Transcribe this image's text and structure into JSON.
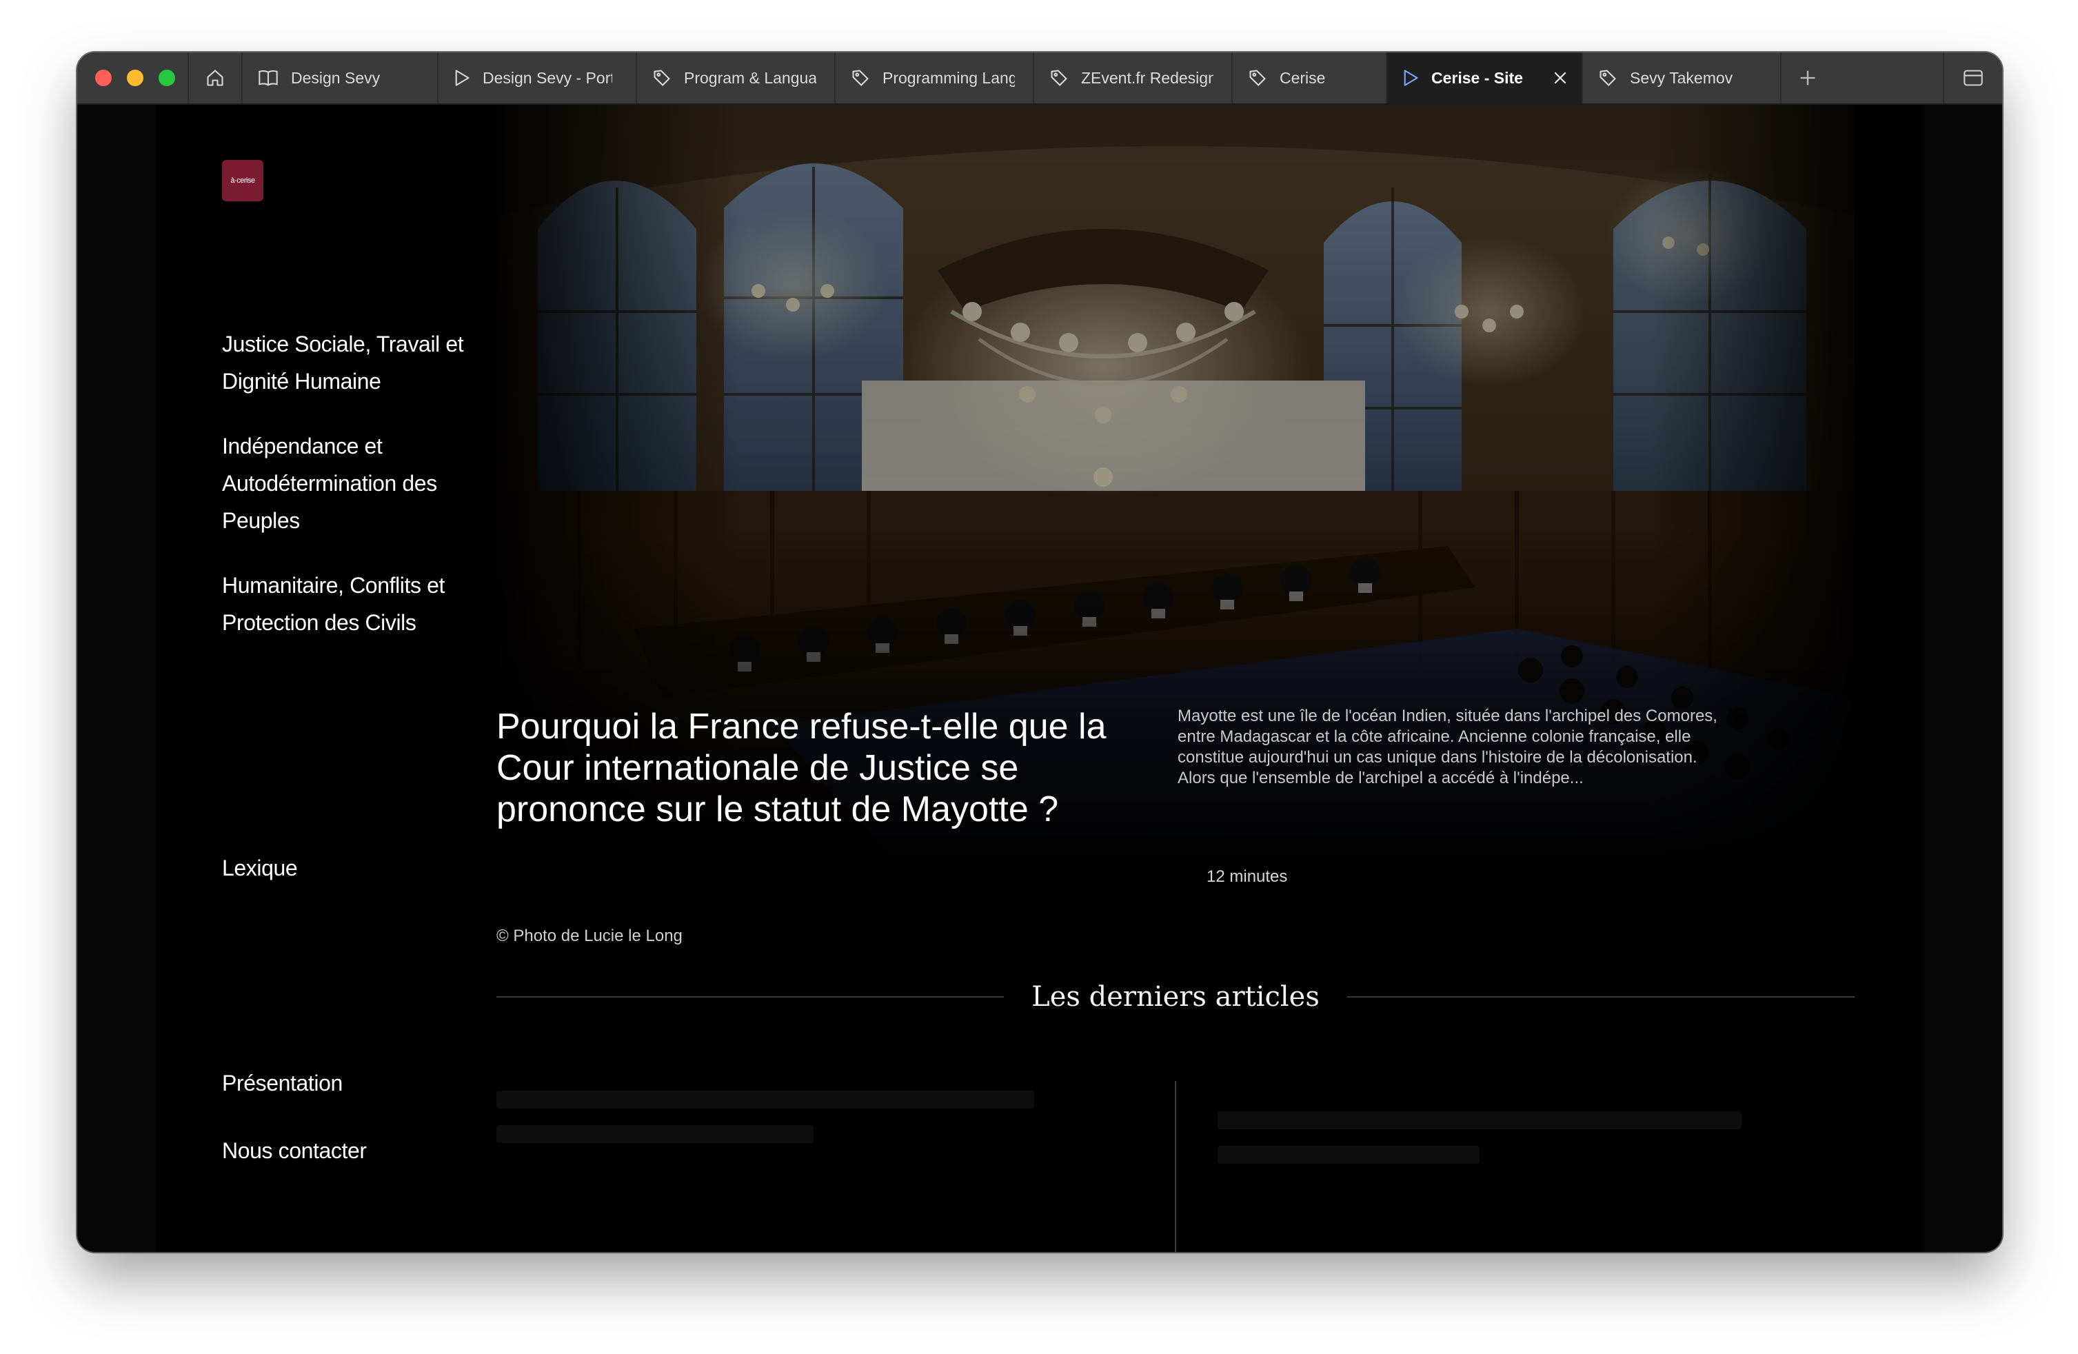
{
  "browser": {
    "tabs": [
      {
        "label": "Design Sevy",
        "icon": "book-icon",
        "active": false
      },
      {
        "label": "Design Sevy - Portfolio",
        "icon": "play-icon",
        "active": false
      },
      {
        "label": "Program & Languages",
        "icon": "tag-icon",
        "active": false
      },
      {
        "label": "Programming Languages",
        "icon": "tag-icon",
        "active": false
      },
      {
        "label": "ZEvent.fr Redesign",
        "icon": "tag-icon",
        "active": false
      },
      {
        "label": "Cerise",
        "icon": "tag-icon",
        "active": false
      },
      {
        "label": "Cerise - Site",
        "icon": "play-icon",
        "active": true
      },
      {
        "label": "Sevy Takemov",
        "icon": "tag-icon",
        "active": false
      }
    ]
  },
  "site": {
    "logo_text": "à·cerise",
    "nav": {
      "item1": "Justice Sociale, Travail et Dignité Humaine",
      "item2": "Indépendance et Autodétermination des Peuples",
      "item3": "Humanitaire, Conflits et Protection des Civils",
      "lexique": "Lexique",
      "presentation": "Présentation",
      "contact": "Nous contacter"
    }
  },
  "hero": {
    "title": "Pourquoi la France refuse-t-elle que la Cour internationale de Justice se prononce sur le statut de Mayotte ?",
    "excerpt": "Mayotte est une île de l'océan Indien, située dans l'archipel des Comores, entre Madagascar et la côte africaine. Ancienne colonie française, elle constitue aujourd'hui un cas unique dans l'histoire de la décolonisation. Alors que l'ensemble de l'archipel a accédé à l'indépe...",
    "reading_time": "12 minutes",
    "photo_credit": "© Photo de Lucie le Long"
  },
  "latest": {
    "heading": "Les derniers articles"
  },
  "colors": {
    "brand": "#7b1a33",
    "tabbar": "#3a3a3b",
    "page_bg": "#000000"
  }
}
